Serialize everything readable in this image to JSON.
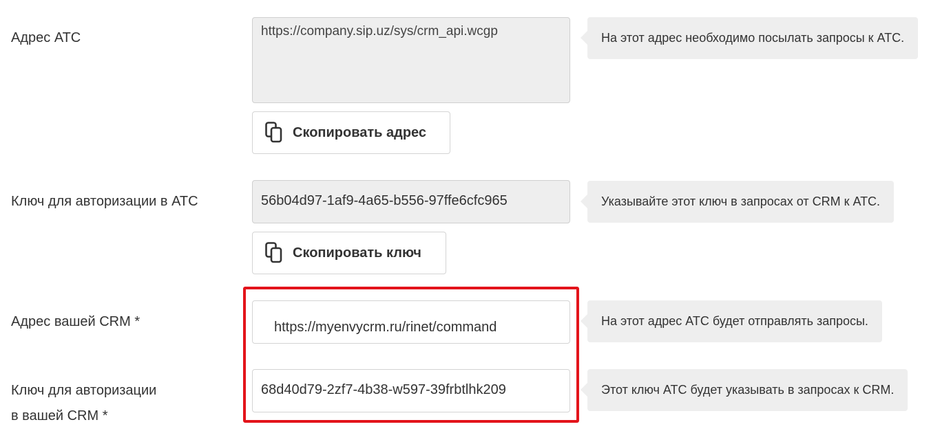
{
  "rows": {
    "ats_address": {
      "label": "Адрес АТС",
      "value": "https://company.sip.uz/sys/crm_api.wcgp",
      "hint": "На этот адрес необходимо посылать запросы к АТС.",
      "copy_button": "Скопировать адрес"
    },
    "ats_key": {
      "label": "Ключ для авторизации в АТС",
      "value": "56b04d97-1af9-4a65-b556-97ffe6cfc965",
      "hint": "Указывайте этот ключ в запросах от CRM к АТС.",
      "copy_button": "Скопировать ключ"
    },
    "crm_address": {
      "label": "Адрес вашей CRM *",
      "value": "https://myenvycrm.ru/rinet/command",
      "hint": "На этот адрес АТС будет отправлять запросы."
    },
    "crm_key": {
      "label_line1": "Ключ для авторизации",
      "label_line2": "в вашей CRM *",
      "value": "68d40d79-2zf7-4b38-w597-39frbtlhk209",
      "hint": "Этот ключ АТС будет указывать в запросах к CRM."
    }
  },
  "icons": {
    "copy": "copy-icon"
  },
  "colors": {
    "highlight": "#e3141b",
    "readonly_bg": "#eeeeee",
    "hint_bg": "#eeeeee",
    "text": "#333333"
  }
}
